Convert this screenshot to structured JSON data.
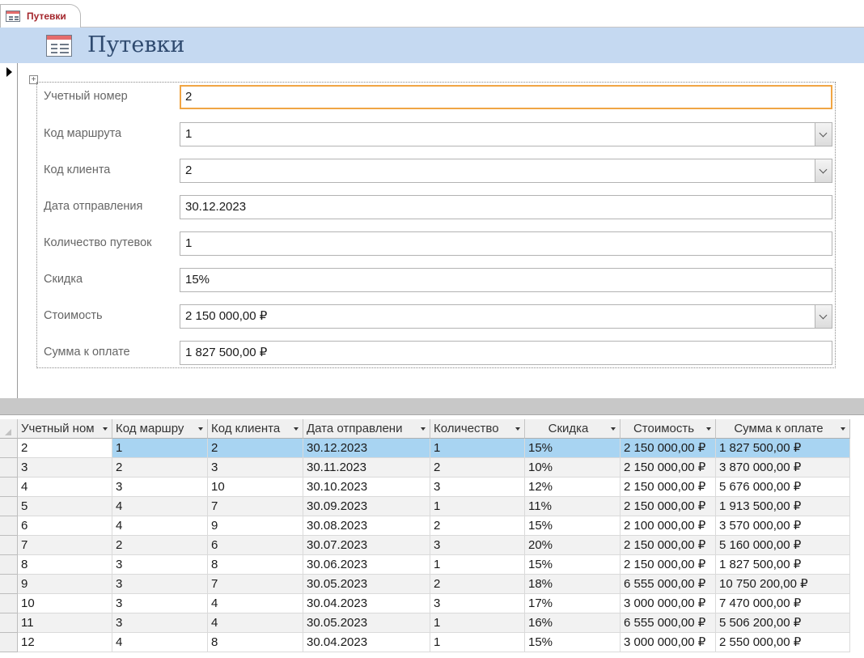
{
  "tab": {
    "label": "Путевки",
    "icon": "form-icon"
  },
  "header": {
    "title": "Путевки",
    "icon": "form-icon"
  },
  "form": {
    "fields": [
      {
        "label": "Учетный номер",
        "value": "2",
        "dropdown": false,
        "focused": true
      },
      {
        "label": "Код маршрута",
        "value": "1",
        "dropdown": true
      },
      {
        "label": "Код клиента",
        "value": "2",
        "dropdown": true
      },
      {
        "label": "Дата отправления",
        "value": "30.12.2023",
        "dropdown": false
      },
      {
        "label": "Количество путевок",
        "value": "1",
        "dropdown": false
      },
      {
        "label": "Скидка",
        "value": "15%",
        "dropdown": false
      },
      {
        "label": "Стоимость",
        "value": "2 150 000,00 ₽",
        "dropdown": true
      },
      {
        "label": "Сумма к оплате",
        "value": "1 827 500,00 ₽",
        "dropdown": false
      }
    ]
  },
  "datasheet": {
    "columns": [
      "Учетный ном",
      "Код маршру",
      "Код клиента",
      "Дата отправлени",
      "Количество",
      "Скидка",
      "Стоимость",
      "Сумма к оплате"
    ],
    "rows": [
      [
        "2",
        "1",
        "2",
        "30.12.2023",
        "1",
        "15%",
        "2 150 000,00 ₽",
        "1 827 500,00 ₽"
      ],
      [
        "3",
        "2",
        "3",
        "30.11.2023",
        "2",
        "10%",
        "2 150 000,00 ₽",
        "3 870 000,00 ₽"
      ],
      [
        "4",
        "3",
        "10",
        "30.10.2023",
        "3",
        "12%",
        "2 150 000,00 ₽",
        "5 676 000,00 ₽"
      ],
      [
        "5",
        "4",
        "7",
        "30.09.2023",
        "1",
        "11%",
        "2 150 000,00 ₽",
        "1 913 500,00 ₽"
      ],
      [
        "6",
        "4",
        "9",
        "30.08.2023",
        "2",
        "15%",
        "2 100 000,00 ₽",
        "3 570 000,00 ₽"
      ],
      [
        "7",
        "2",
        "6",
        "30.07.2023",
        "3",
        "20%",
        "2 150 000,00 ₽",
        "5 160 000,00 ₽"
      ],
      [
        "8",
        "3",
        "8",
        "30.06.2023",
        "1",
        "15%",
        "2 150 000,00 ₽",
        "1 827 500,00 ₽"
      ],
      [
        "9",
        "3",
        "7",
        "30.05.2023",
        "2",
        "18%",
        "6 555 000,00 ₽",
        "10 750 200,00 ₽"
      ],
      [
        "10",
        "3",
        "4",
        "30.04.2023",
        "3",
        "17%",
        "3 000 000,00 ₽",
        "7 470 000,00 ₽"
      ],
      [
        "11",
        "3",
        "4",
        "30.05.2023",
        "1",
        "16%",
        "6 555 000,00 ₽",
        "5 506 200,00 ₽"
      ],
      [
        "12",
        "4",
        "8",
        "30.04.2023",
        "1",
        "15%",
        "3 000 000,00 ₽",
        "2 550 000,00 ₽"
      ]
    ],
    "selected_row": 0
  },
  "colors": {
    "header_band": "#c5d9f1",
    "tab_text": "#a4262c",
    "selection": "#a8d4f2",
    "focus_border": "#f0a544"
  }
}
